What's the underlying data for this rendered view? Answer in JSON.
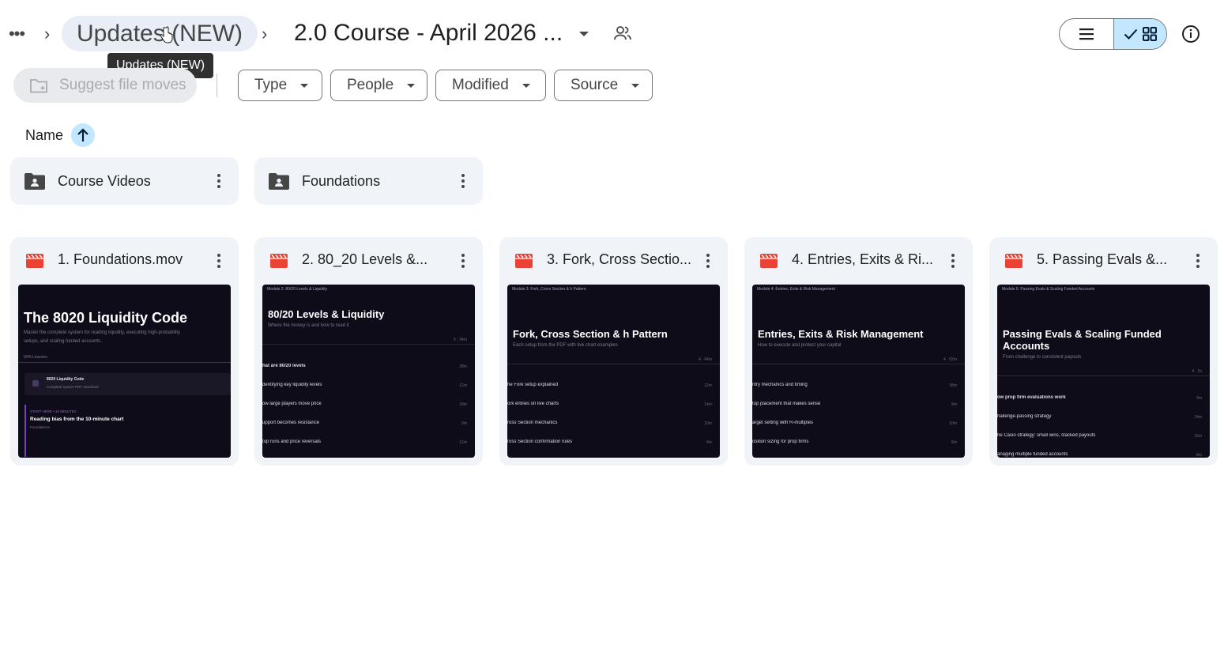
{
  "breadcrumb": {
    "more": "•••",
    "parent": "Updates (NEW)",
    "current": "2.0 Course - April 2026 ...",
    "tooltip": "Updates (NEW)"
  },
  "toolbar": {
    "suggest_label": "Suggest file moves",
    "filters": [
      "Type",
      "People",
      "Modified",
      "Source"
    ]
  },
  "sort": {
    "label": "Name",
    "direction": "ascending"
  },
  "folders": [
    {
      "name": "Course Videos"
    },
    {
      "name": "Foundations"
    }
  ],
  "files": [
    {
      "name": "1. Foundations.mov",
      "thumb": {
        "title": "The 8020 Liquidity Code",
        "subtitle1": "Master the complete system for reading liquidity, executing high-probability",
        "subtitle2": "setups, and scaling funded accounts.",
        "progress": "0/45 Lessons",
        "item_title": "8020 Liquidity Code",
        "item_sub": "Complete system PDF download",
        "tag": "START HERE • 10 MINUTES",
        "lesson": "Reading bias from the 10-minute chart",
        "lesson_sub": "Foundations"
      }
    },
    {
      "name": "2. 80_20 Levels &...",
      "thumb": {
        "module": "Module 2: 80/20 Levels & Liquidity",
        "title": "80/20 Levels & Liquidity",
        "subtitle": "Where the money is and how to read it",
        "meta": "5 · 34m",
        "rows": [
          {
            "text": "hat are 80/20 levels",
            "dur": "28m"
          },
          {
            "text": "dentifying key liquidity levels",
            "dur": "12m"
          },
          {
            "text": "ow large players move price",
            "dur": "18m"
          },
          {
            "text": "upport becomes resistance",
            "dur": "9m"
          },
          {
            "text": "top runs and price reversals",
            "dur": "12m"
          }
        ]
      }
    },
    {
      "name": "3. Fork, Cross Sectio...",
      "thumb": {
        "module": "Module 3: Fork, Cross Section & h Pattern",
        "title": "Fork, Cross Section & h Pattern",
        "subtitle": "Each setup from the PDF with live chart examples",
        "meta": "4 · 44m",
        "rows": [
          {
            "text": "he Fork setup explained",
            "dur": "12m"
          },
          {
            "text": "ork entries on live charts",
            "dur": "14m"
          },
          {
            "text": "ross Section mechanics",
            "dur": "10m"
          },
          {
            "text": "ross Section confirmation rules",
            "dur": "8m"
          }
        ]
      }
    },
    {
      "name": "4. Entries, Exits & Ri...",
      "thumb": {
        "module": "Module 4: Entries, Exits & Risk Management",
        "title": "Entries, Exits & Risk Management",
        "subtitle": "How to execute and protect your capital",
        "meta": "4 · 52m",
        "rows": [
          {
            "text": "ntry mechanics and timing",
            "dur": "18m"
          },
          {
            "text": "top placement that makes sense",
            "dur": "9m"
          },
          {
            "text": "arget setting with R-multiples",
            "dur": "10m"
          },
          {
            "text": "osition sizing for prop firms",
            "dur": "8m"
          }
        ]
      }
    },
    {
      "name": "5. Passing Evals &...",
      "thumb": {
        "module": "Module 5: Passing Evals & Scaling Funded Accounts",
        "title1": "Passing Evals & Scaling Funded",
        "title2": "Accounts",
        "subtitle": "From challenge to consistent payouts",
        "meta": "4 · 1h",
        "rows": [
          {
            "text": "ow prop firm evaluations work",
            "dur": "9m"
          },
          {
            "text": "hallenge-passing strategy",
            "dur": "14m"
          },
          {
            "text": "he Casio strategy: small wins, stacked payouts",
            "dur": "15m"
          },
          {
            "text": "anaging multiple funded accounts",
            "dur": "8m"
          }
        ]
      }
    }
  ],
  "colors": {
    "selected_toggle": "#c2e7ff",
    "folder_bg": "#f0f4f9",
    "video_icon": "#ea4335",
    "thumb_bg": "#0e0c18",
    "accent_purple": "#7b3fbf"
  }
}
